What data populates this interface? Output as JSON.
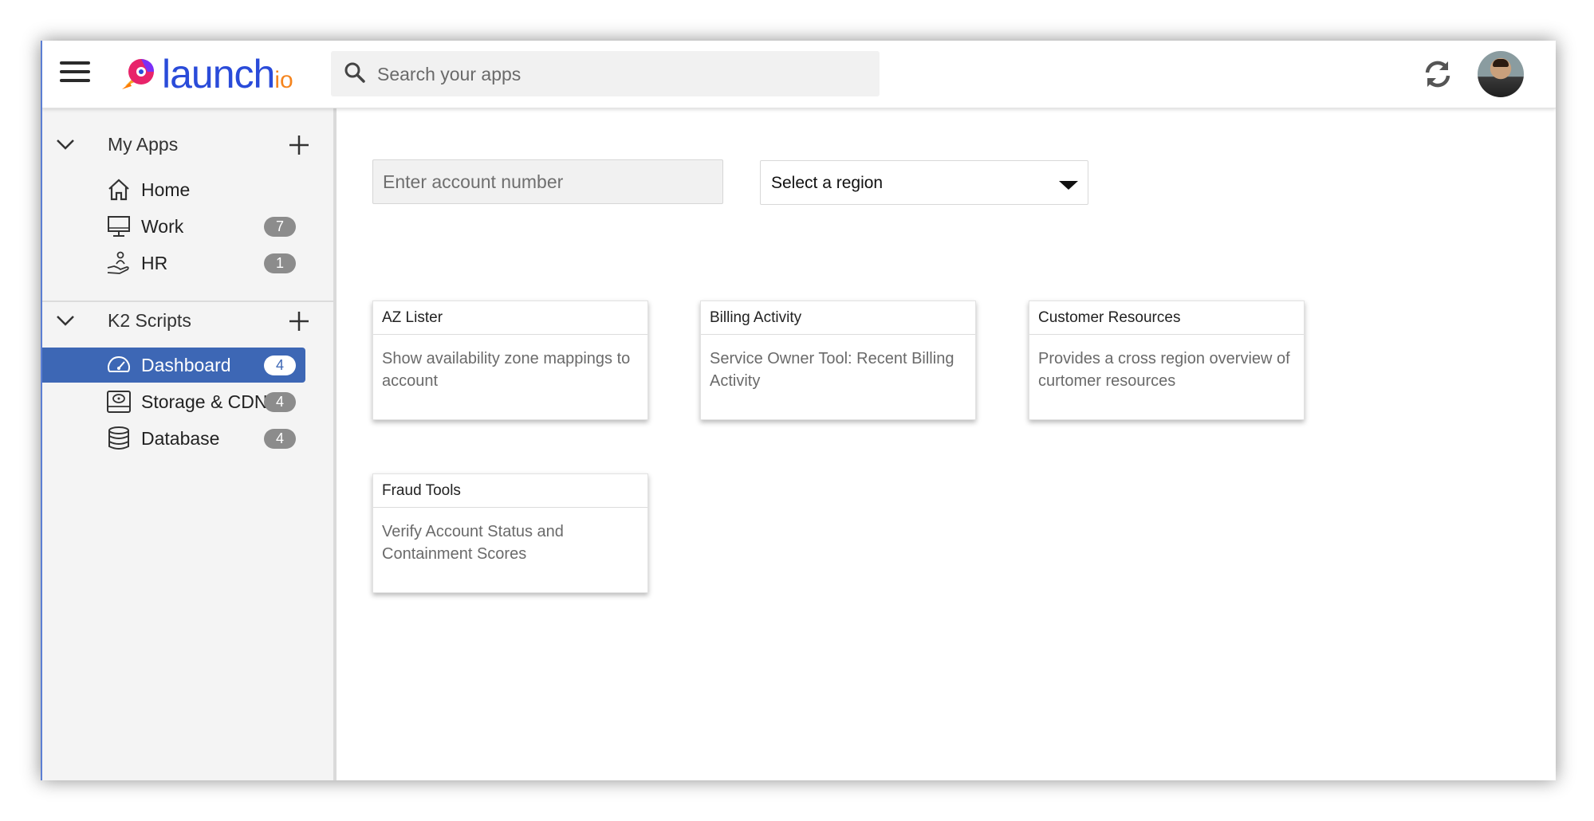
{
  "header": {
    "logo_text": "launch",
    "logo_sub": "io",
    "search_placeholder": "Search your apps",
    "icons": {
      "menu": "menu-icon",
      "search": "search-icon",
      "refresh": "refresh-icon",
      "avatar": "user-avatar"
    }
  },
  "sidebar": {
    "groups": [
      {
        "title": "My Apps",
        "items": [
          {
            "label": "Home",
            "icon": "home-icon"
          },
          {
            "label": "Work",
            "icon": "monitor-icon",
            "badge": "7"
          },
          {
            "label": "HR",
            "icon": "hand-person-icon",
            "badge": "1"
          }
        ]
      },
      {
        "title": "K2 Scripts",
        "items": [
          {
            "label": "Dashboard",
            "icon": "dashboard-gauge-icon",
            "badge": "4",
            "active": true
          },
          {
            "label": "Storage & CDN",
            "icon": "hard-drive-icon",
            "badge": "4"
          },
          {
            "label": "Database",
            "icon": "database-icon",
            "badge": "4"
          }
        ]
      }
    ]
  },
  "main": {
    "account_placeholder": "Enter account number",
    "region_select": {
      "value": "Select a region"
    },
    "cards": [
      {
        "title": "AZ Lister",
        "description": "Show availability zone mappings to account"
      },
      {
        "title": "Billing Activity",
        "description": "Service Owner Tool: Recent Billing Activity"
      },
      {
        "title": "Customer Resources",
        "description": "Provides a cross region overview of curtomer resources"
      },
      {
        "title": "Fraud Tools",
        "description": "Verify Account Status and Containment Scores"
      }
    ]
  },
  "colors": {
    "active": "#3d67b5",
    "brand_blue": "#2a4bd9",
    "brand_orange": "#f5851f"
  }
}
